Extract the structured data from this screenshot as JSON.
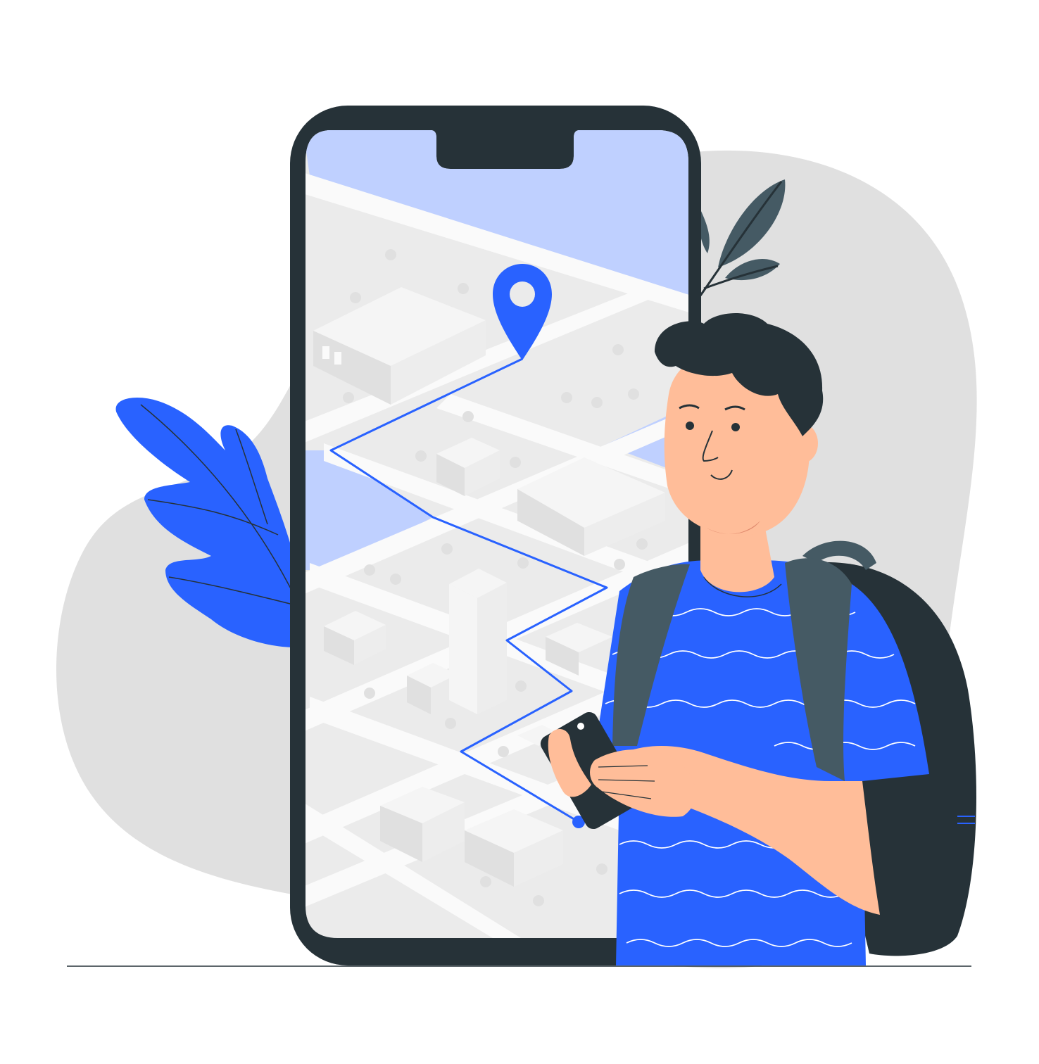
{
  "illustration": {
    "subject": "person-with-phone-navigation",
    "icons": {
      "location_pin": "map-pin-icon",
      "route_end": "route-end-dot-icon",
      "device": "smartphone-icon"
    },
    "colors": {
      "accent_blue": "#2962ff",
      "light_blue": "#bfd0ff",
      "dark": "#263238",
      "slate": "#455a64",
      "skin": "#ffbd99",
      "blob_gray": "#e0e0e0",
      "map_gray": "#ebebeb",
      "road_white": "#fafafa",
      "building_light": "#f5f5f5",
      "building_shade": "#e0e0e0"
    }
  }
}
